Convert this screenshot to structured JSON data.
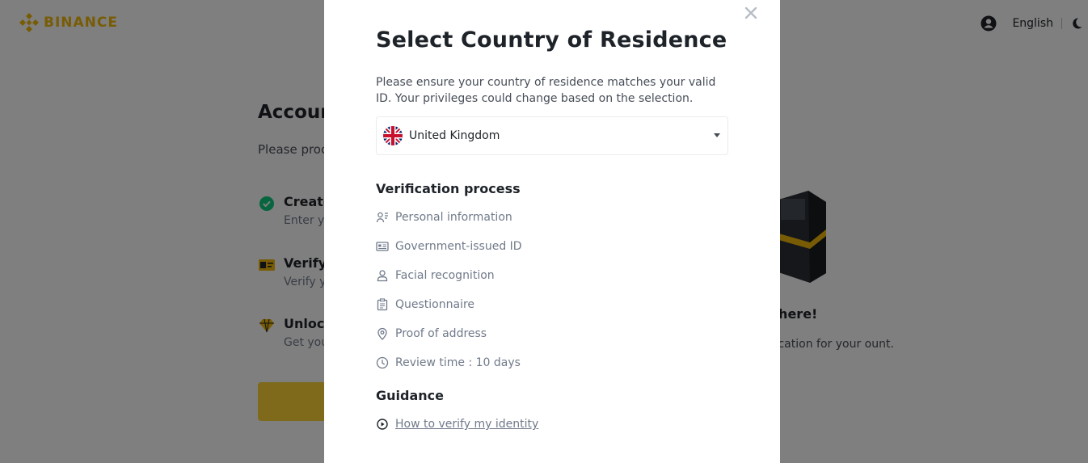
{
  "brand": {
    "name": "BINANCE",
    "color": "#F0B90B"
  },
  "header": {
    "language": "English",
    "user_icon": "user-circle-icon",
    "theme_icon": "moon-icon"
  },
  "background_page": {
    "title": "Accoun",
    "subtitle": "Please proc",
    "steps": [
      {
        "icon": "check-circle-icon",
        "title": "Create",
        "desc": "Enter yo"
      },
      {
        "icon": "id-card-icon",
        "title": "Verify I",
        "desc": "Verify yo"
      },
      {
        "icon": "diamond-icon",
        "title": "Unlock",
        "desc": "Get you"
      }
    ],
    "promo": {
      "title": "most there!",
      "text": "ity verification for your ount."
    }
  },
  "modal": {
    "title": "Select Country of Residence",
    "description": "Please ensure your country of residence matches your valid ID. Your privileges could change based on the selection.",
    "country": {
      "selected": "United Kingdom",
      "flag": "uk-flag-icon"
    },
    "verification_heading": "Verification process",
    "process_items": [
      {
        "icon": "personal-info-icon",
        "label": "Personal information"
      },
      {
        "icon": "id-card-icon",
        "label": "Government-issued ID"
      },
      {
        "icon": "person-icon",
        "label": "Facial recognition"
      },
      {
        "icon": "clipboard-icon",
        "label": "Questionnaire"
      },
      {
        "icon": "location-pin-icon",
        "label": "Proof of address"
      },
      {
        "icon": "clock-icon",
        "label": "Review time : 10 days"
      }
    ],
    "guidance_heading": "Guidance",
    "guidance_link": "How to verify my identity"
  }
}
